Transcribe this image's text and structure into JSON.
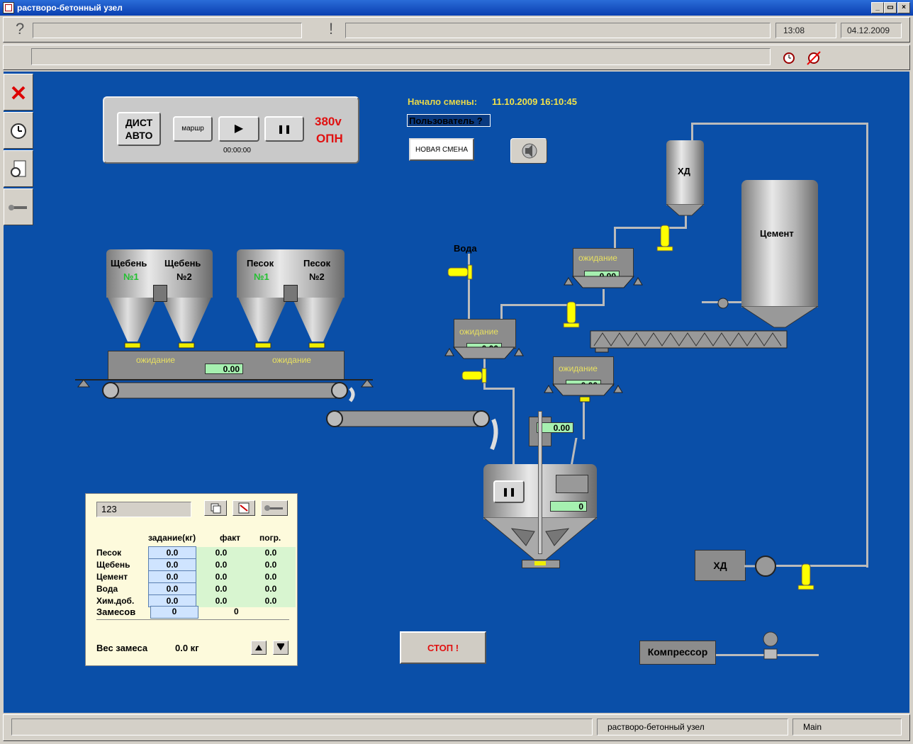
{
  "window": {
    "title": "растворо-бетонный узел",
    "controls": [
      "_",
      "▭",
      "×"
    ]
  },
  "topbar": {
    "help_glyph": "?",
    "alert_glyph": "!",
    "time": "13:08",
    "date": "04.12.2009"
  },
  "panel": {
    "mode_line1": "ДИСТ",
    "mode_line2": "АВТО",
    "route_label": "маршр",
    "play_glyph": "▶",
    "pause_glyph": "❚❚",
    "timer": "00:00:00",
    "voltage": "380v",
    "opn": "ОПН"
  },
  "shift": {
    "start_label": "Начало смены:",
    "start_value": "11.10.2009 16:10:45",
    "user_label": "Пользователь ?",
    "new_shift_label": "НОВАЯ СМЕНА"
  },
  "bins": {
    "gravel1": "Щебень",
    "gravel1_no": "№1",
    "gravel2": "Щебень",
    "gravel2_no": "№2",
    "sand1": "Песок",
    "sand1_no": "№1",
    "sand2": "Песок",
    "sand2_no": "№2"
  },
  "scales": {
    "wait": "ожидание",
    "agg_left_wait": "ожидание",
    "agg_right_wait": "ожидание",
    "agg_value": "0.00",
    "cement_wait": "ожидание",
    "cement_value": "0.00",
    "water_wait": "ожидание",
    "water_value": "0.00",
    "chem_wait": "ожидание",
    "chem_value": "0.00",
    "dose_value": "0.00",
    "mixer_value": "0"
  },
  "labels": {
    "water": "Вода",
    "hd_top": "ХД",
    "cement": "Цемент",
    "hd_bottom": "ХД",
    "compressor": "Компрессор",
    "mixer_pause": "❚❚"
  },
  "recipe": {
    "name": "123",
    "headers": [
      "задание(кг)",
      "факт",
      "погр."
    ],
    "rows": [
      {
        "name": "Песок",
        "task": "0.0",
        "fact": "0.0",
        "err": "0.0"
      },
      {
        "name": "Щебень",
        "task": "0.0",
        "fact": "0.0",
        "err": "0.0"
      },
      {
        "name": "Цемент",
        "task": "0.0",
        "fact": "0.0",
        "err": "0.0"
      },
      {
        "name": "Вода",
        "task": "0.0",
        "fact": "0.0",
        "err": "0.0"
      },
      {
        "name": "Хим.доб.",
        "task": "0.0",
        "fact": "0.0",
        "err": "0.0"
      }
    ],
    "batches_label": "Замесов",
    "batches_task": "0",
    "batches_fact": "0",
    "weight_label": "Вес замеса",
    "weight_value": "0.0 кг"
  },
  "stop_label": "СТОП !",
  "statusbar": {
    "app": "растворо-бетонный узел",
    "screen": "Main"
  }
}
